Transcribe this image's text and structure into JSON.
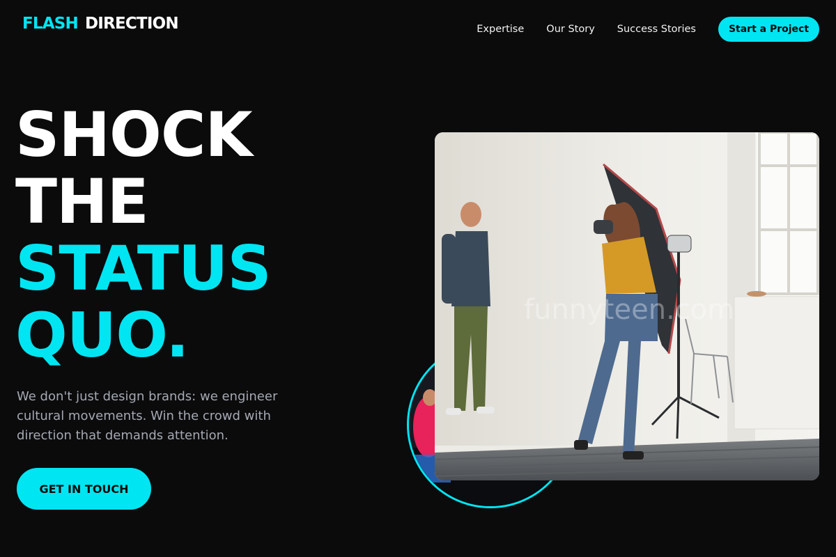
{
  "header": {
    "logo_part1": "FLASH",
    "logo_part2": "DIRECTION",
    "nav": [
      "Expertise",
      "Our Story",
      "Success Stories"
    ],
    "cta_label": "Start a Project"
  },
  "hero": {
    "line1": "SHOCK",
    "line2": "THE",
    "line3": "STATUS",
    "line4": "QUO.",
    "subtext": "We don't just design brands: we engineer cultural movements. Win the crowd with direction that demands attention.",
    "button_label": "GET IN TOUCH"
  },
  "colors": {
    "background": "#0b0b0c",
    "accent": "#00e5f2",
    "text": "#ffffff",
    "muted": "#a5a9b3"
  },
  "images": {
    "photo_watermark": "funnyteen.com"
  }
}
